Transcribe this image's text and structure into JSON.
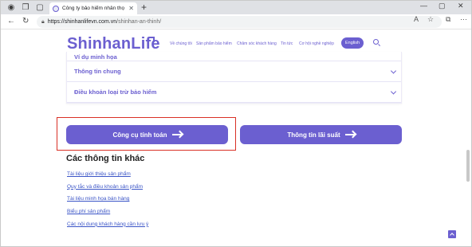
{
  "browser": {
    "tab_title": "Công ty bảo hiểm nhân thọ Shinh",
    "new_tab_glyph": "+",
    "url_domain": "https://shinhanlifevn.com.vn",
    "url_path": "/shinhan-an-thinh/",
    "icons": [
      "profile-icon",
      "workspaces-icon",
      "tab-actions-icon",
      "back-icon",
      "refresh-icon",
      "lock-icon",
      "read-aloud-icon",
      "favorite-icon",
      "extensions-icon",
      "more-icon"
    ]
  },
  "header": {
    "logo": "ShinhanLife",
    "nav": [
      "Về chúng tôi",
      "Sản phẩm bảo hiểm",
      "Chăm sóc khách hàng",
      "Tin tức",
      "Cơ hội nghề nghiệp"
    ],
    "language_button": "English"
  },
  "accordion": {
    "items": [
      {
        "label": "Ví dụ minh họa"
      },
      {
        "label": "Thông tin chung"
      },
      {
        "label": "Điều khoản loại trừ bảo hiểm"
      }
    ]
  },
  "buttons": {
    "calculator": "Công cụ tính toán",
    "interest": "Thông tin lãi suất"
  },
  "other_info": {
    "title": "Các thông tin khác",
    "links": [
      "Tài liệu giới thiệu sản phẩm",
      "Quy tắc và điều khoản sản phẩm",
      "Tài liệu minh họa bán hàng",
      "Biểu phí sản phẩm",
      "Các nội dung khách hàng cần lưu ý"
    ]
  },
  "colors": {
    "brand": "#6b5fd0",
    "highlight": "#d93025",
    "link": "#3b55c7"
  }
}
